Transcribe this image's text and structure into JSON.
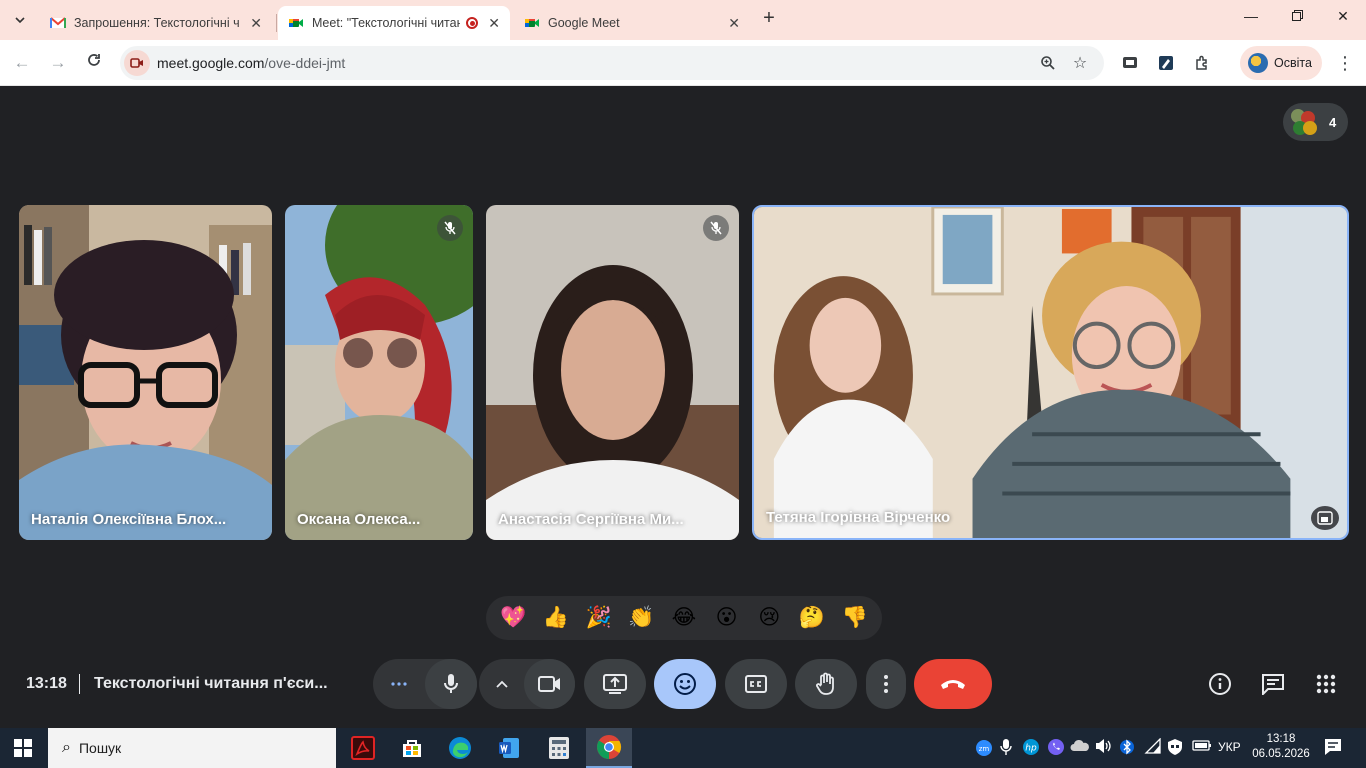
{
  "browser": {
    "tabs": [
      {
        "title": "Запрошення: Текстологічні чи",
        "favicon": "gmail-icon",
        "active": false
      },
      {
        "title": "Meet: \"Текстологічні читан",
        "favicon": "meet-icon",
        "active": true,
        "recording": true
      },
      {
        "title": "Google Meet",
        "favicon": "meet-icon",
        "active": false
      }
    ],
    "url_host": "meet.google.com",
    "url_path": "/ove-ddei-jmt",
    "profile_name": "Освіта"
  },
  "meet": {
    "participant_count": "4",
    "participants": [
      {
        "name": "Наталія Олексіївна Блох...",
        "muted": false
      },
      {
        "name": "Оксана Олекса...",
        "muted": true
      },
      {
        "name": "Анастасія Сергіївна Ми...",
        "muted": true
      },
      {
        "name": "Тетяна Ігорівна Вірченко",
        "muted": false,
        "spotlight": true
      }
    ],
    "reactions": [
      "💖",
      "👍",
      "🎉",
      "👏",
      "😂",
      "😮",
      "😢",
      "🤔",
      "👎"
    ],
    "time": "13:18",
    "meeting_title": "Текстологічні читання п'єси..."
  },
  "taskbar": {
    "search_label": "Пошук",
    "language": "УКР",
    "time": "13:18",
    "date": "06.05.2026"
  },
  "colors": {
    "accent": "#a8c7fa",
    "end_call": "#ea4335",
    "stage_bg": "#202124",
    "tab_strip": "#fbe3dd"
  }
}
